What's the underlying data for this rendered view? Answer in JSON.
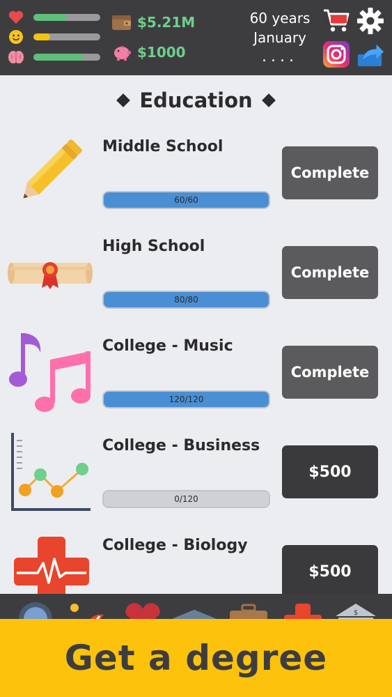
{
  "status": {
    "stats": [
      {
        "name": "health",
        "icon": "heart-icon",
        "level": 0.5,
        "color": "#5fbf7a"
      },
      {
        "name": "happiness",
        "icon": "smiley-icon",
        "level": 0.25,
        "color": "#f2c311"
      },
      {
        "name": "smarts",
        "icon": "brain-icon",
        "level": 0.75,
        "color": "#5fbf7a"
      }
    ],
    "net_worth": "$5.21M",
    "cash": "$1000",
    "age": "60 years",
    "month": "January",
    "dots": "...."
  },
  "header_icons": [
    "shopping-cart-icon",
    "gear-icon",
    "instagram-icon",
    "share-icon"
  ],
  "section_title": "Education",
  "education": [
    {
      "title": "Middle School",
      "progress_text": "60/60",
      "progress": 1.0,
      "action": "Complete",
      "state": "done",
      "icon": "pencil-icon"
    },
    {
      "title": "High School",
      "progress_text": "80/80",
      "progress": 1.0,
      "action": "Complete",
      "state": "done",
      "icon": "diploma-icon"
    },
    {
      "title": "College - Music",
      "progress_text": "120/120",
      "progress": 1.0,
      "action": "Complete",
      "state": "done",
      "icon": "music-notes-icon"
    },
    {
      "title": "College - Business",
      "progress_text": "0/120",
      "progress": 0.0,
      "action": "$500",
      "state": "buy",
      "icon": "line-chart-icon"
    },
    {
      "title": "College - Biology",
      "progress_text": "",
      "progress": 0.0,
      "action": "$500",
      "state": "buy",
      "icon": "medical-cross-icon"
    }
  ],
  "nav_items": [
    "magnifier-icon",
    "beach-icon",
    "heart-icon",
    "graduation-cap-icon",
    "briefcase-icon",
    "medical-icon",
    "bank-icon"
  ],
  "banner": "Get a degree",
  "colors": {
    "topbar": "#3d3d3f",
    "accent": "#fdc20b",
    "money": "#6ecf8c",
    "progress": "#4a8fd4"
  }
}
